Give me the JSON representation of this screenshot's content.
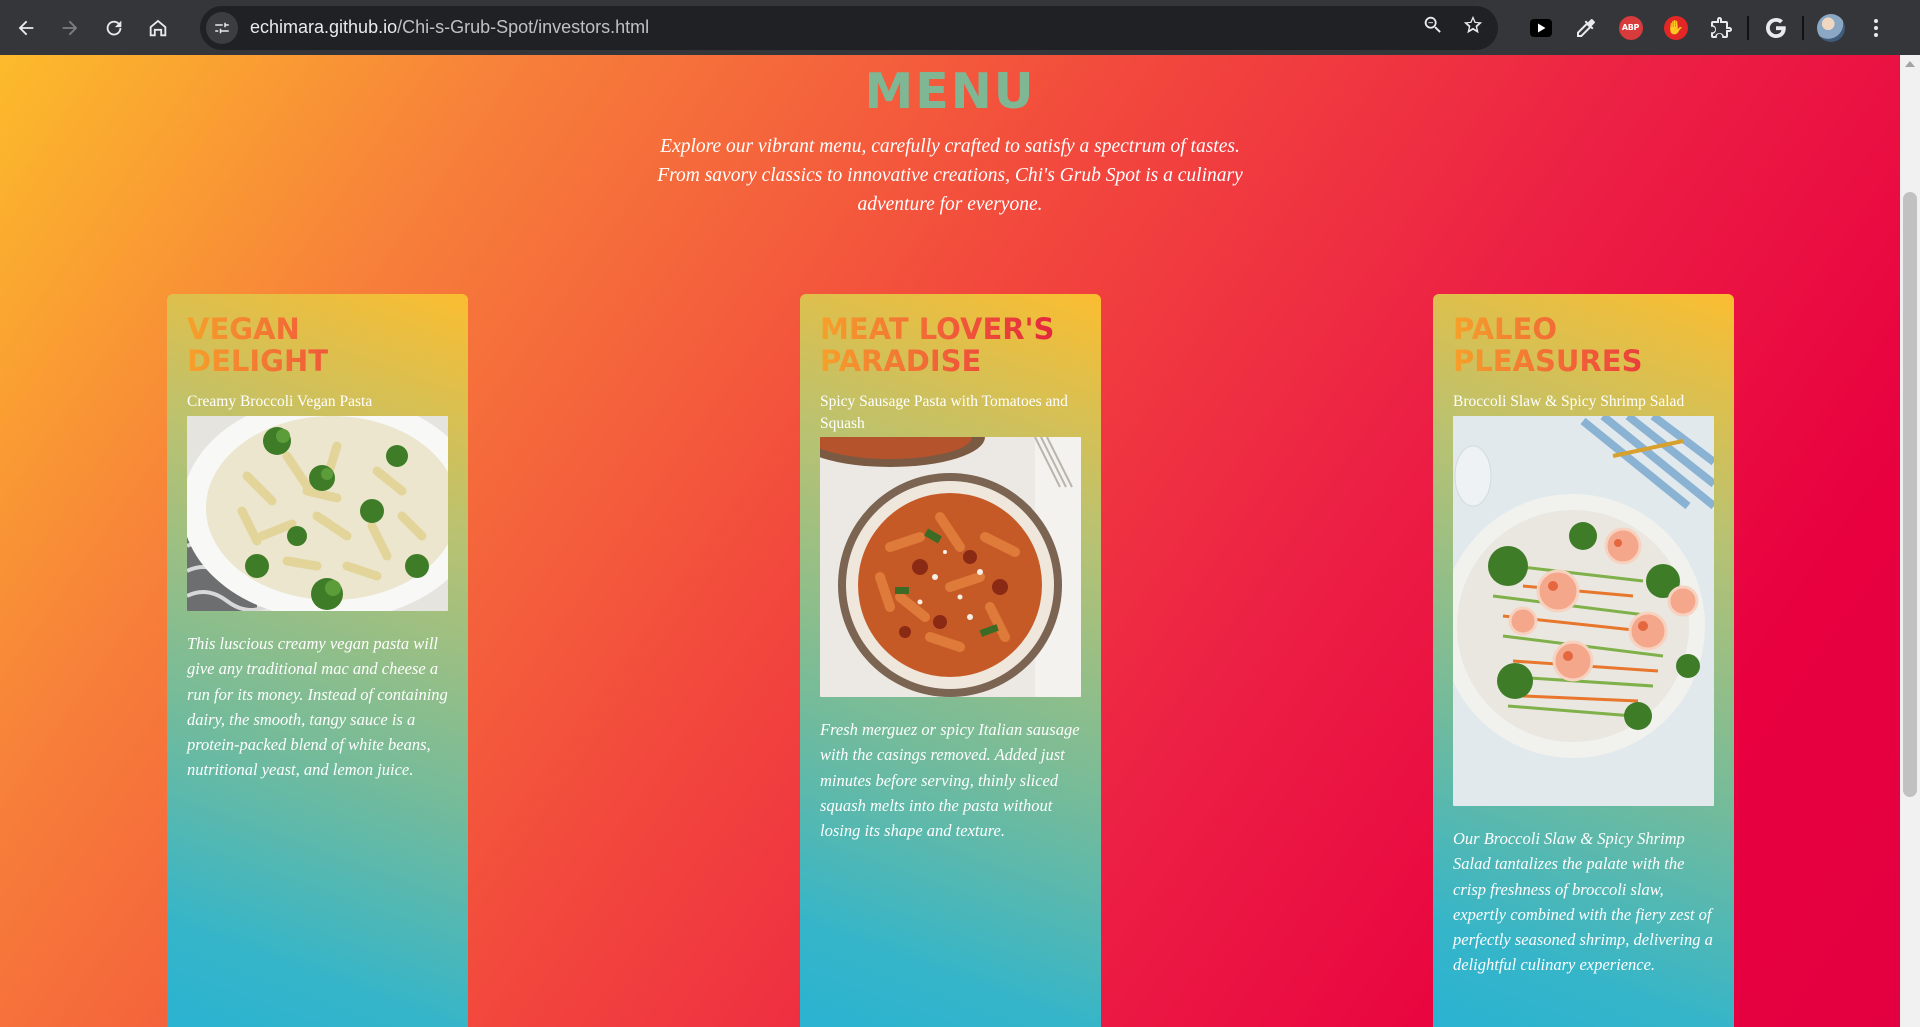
{
  "browser": {
    "url_host": "echimara.github.io",
    "url_path": "/Chi-s-Grub-Spot/investors.html",
    "extensions": [
      "play-icon",
      "eyedropper-icon",
      "abp-icon",
      "stop-hand-icon",
      "puzzle-icon",
      "google-icon",
      "profile-avatar",
      "kebab-menu-icon"
    ],
    "abp_label": "ABP"
  },
  "page": {
    "title": "MENU",
    "intro": "Explore our vibrant menu, carefully crafted to satisfy a spectrum of tastes. From savory classics to innovative creations, Chi's Grub Spot is a culinary adventure for everyone.",
    "title_color": "#7fb795"
  },
  "cards": [
    {
      "title": "VEGAN DELIGHT",
      "dish": "Creamy Broccoli Vegan Pasta",
      "description": "This luscious creamy vegan pasta will give any traditional mac and cheese a run for its money. Instead of containing dairy, the smooth, tangy sauce is a protein-packed blend of white beans, nutritional yeast, and lemon juice."
    },
    {
      "title": "MEAT LOVER'S PARADISE",
      "dish": "Spicy Sausage Pasta with Tomatoes and Squash",
      "description": "Fresh merguez or spicy Italian sausage with the casings removed. Added just minutes before serving, thinly sliced squash melts into the pasta without losing its shape and texture."
    },
    {
      "title": "PALEO PLEASURES",
      "dish": "Broccoli Slaw & Spicy Shrimp Salad",
      "description": "Our Broccoli Slaw & Spicy Shrimp Salad tantalizes the palate with the crisp freshness of broccoli slaw, expertly combined with the fiery zest of perfectly seasoned shrimp, delivering a delightful culinary experience."
    }
  ]
}
